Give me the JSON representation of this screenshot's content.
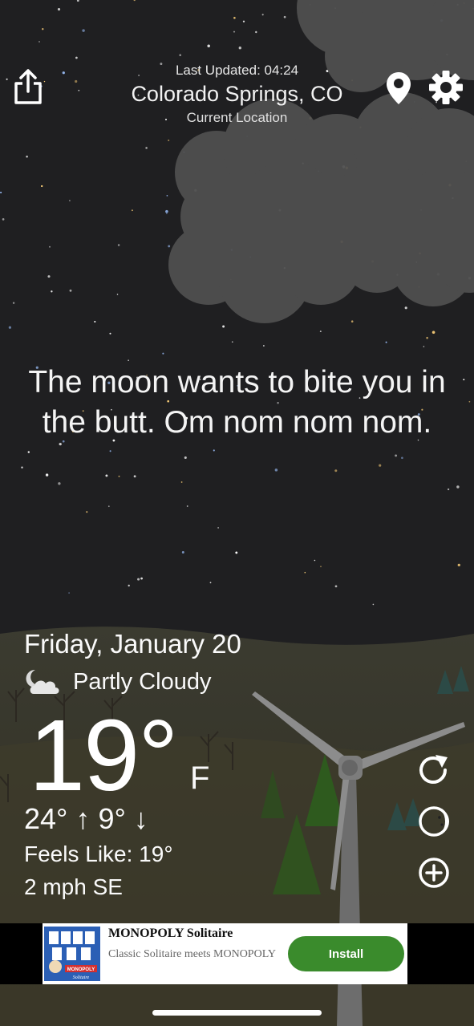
{
  "header": {
    "last_updated": "Last Updated: 04:24",
    "location_name": "Colorado Springs, CO",
    "location_sub": "Current Location"
  },
  "icons": {
    "share": "share-icon",
    "location": "location-pin-icon",
    "settings": "gear-icon",
    "condition": "partly-cloudy-night-icon",
    "refresh": "refresh-icon",
    "moon": "moon-phase-icon",
    "add": "add-circle-icon"
  },
  "message": "The moon wants to bite you in the butt. Om nom nom nom.",
  "weather": {
    "date": "Friday, January 20",
    "condition": "Partly Cloudy",
    "temperature": "19°",
    "unit": "F",
    "hi_lo": "24° ↑  9° ↓",
    "feels_like": "Feels Like: 19°",
    "wind": "2 mph SE"
  },
  "ad": {
    "title": "MONOPOLY Solitaire",
    "description": "Classic Solitaire meets MONOPOLY",
    "install_label": "Install",
    "thumb_text_1": "MONOPOLY",
    "thumb_text_2": "Solitaire"
  },
  "colors": {
    "sky": "#1f1f21",
    "clouds": "#555555",
    "ground": "#3e3a2a",
    "install_button": "#3a8b2c",
    "ad_background": "#ffffff"
  }
}
